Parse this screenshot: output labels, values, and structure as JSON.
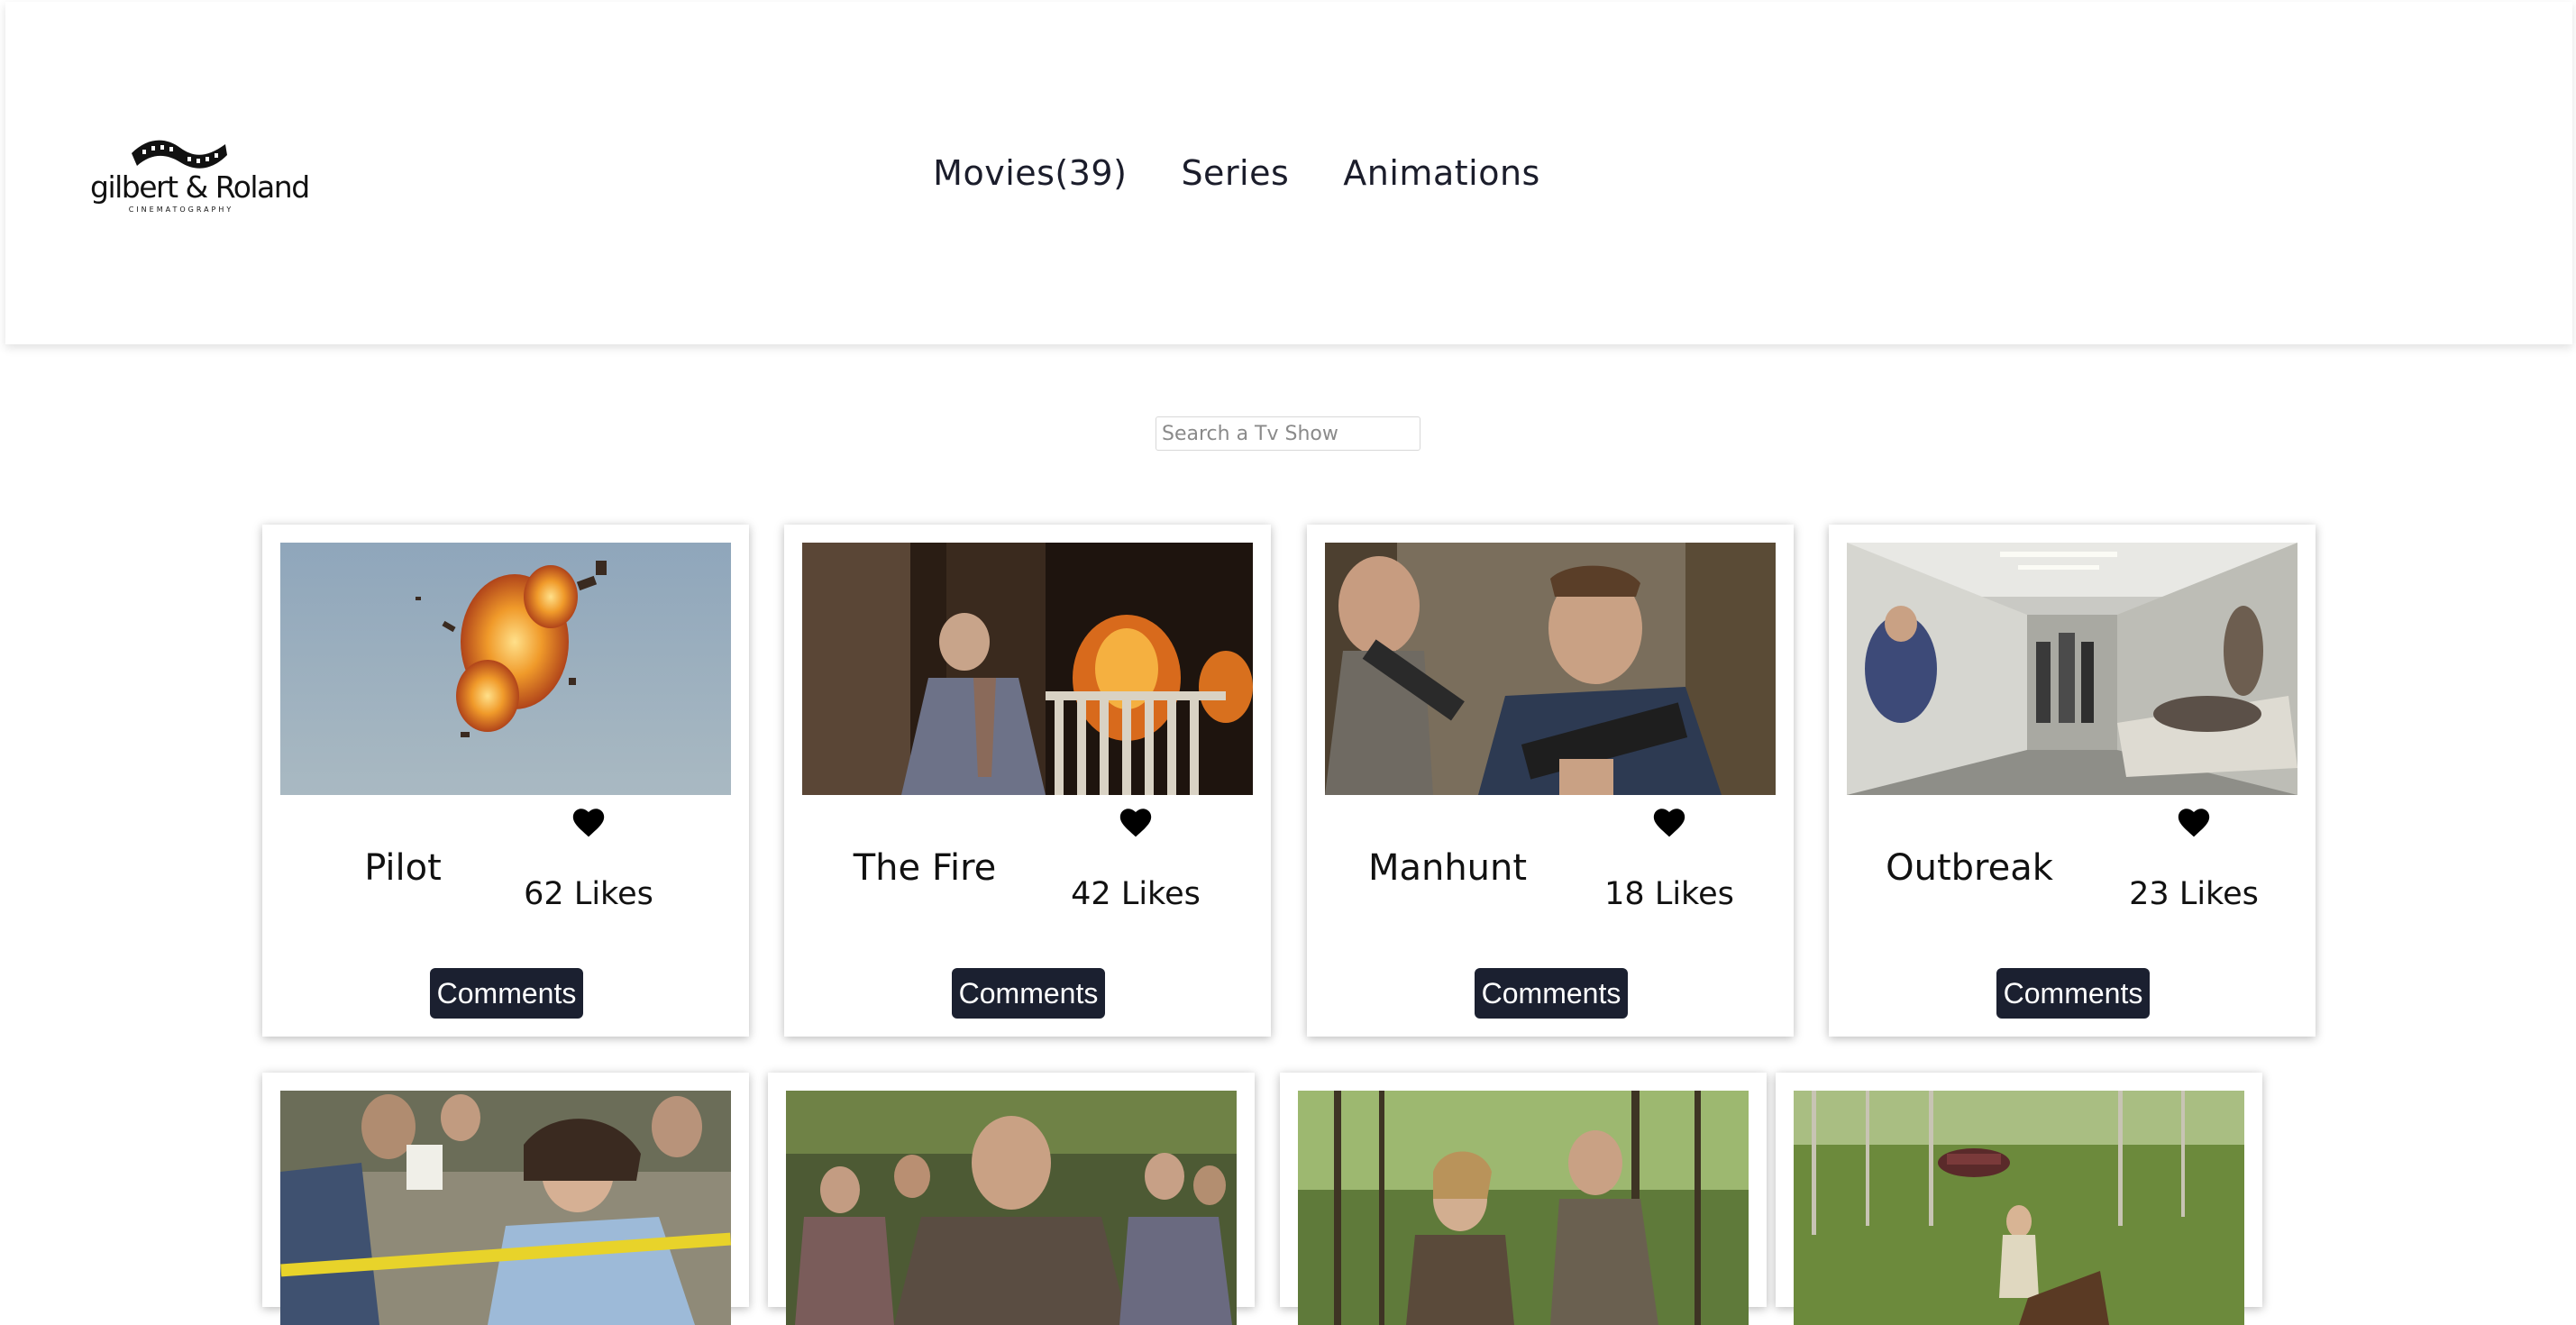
{
  "brand": {
    "name": "gilbert & Roland",
    "tagline": "CINEMATOGRAPHY"
  },
  "nav": {
    "items": [
      {
        "label": "Movies(39)"
      },
      {
        "label": "Series"
      },
      {
        "label": "Animations"
      }
    ]
  },
  "search": {
    "placeholder": "Search a Tv Show",
    "value": ""
  },
  "shows": [
    {
      "title": "Pilot",
      "likes": "62 Likes",
      "comments_label": "Comments"
    },
    {
      "title": "The Fire",
      "likes": "42 Likes",
      "comments_label": "Comments"
    },
    {
      "title": "Manhunt",
      "likes": "18 Likes",
      "comments_label": "Comments"
    },
    {
      "title": "Outbreak",
      "likes": "23 Likes",
      "comments_label": "Comments"
    }
  ],
  "colors": {
    "button_bg": "#1b2030",
    "text": "#1b1d2b"
  },
  "icons": {
    "like": "heart-icon"
  }
}
